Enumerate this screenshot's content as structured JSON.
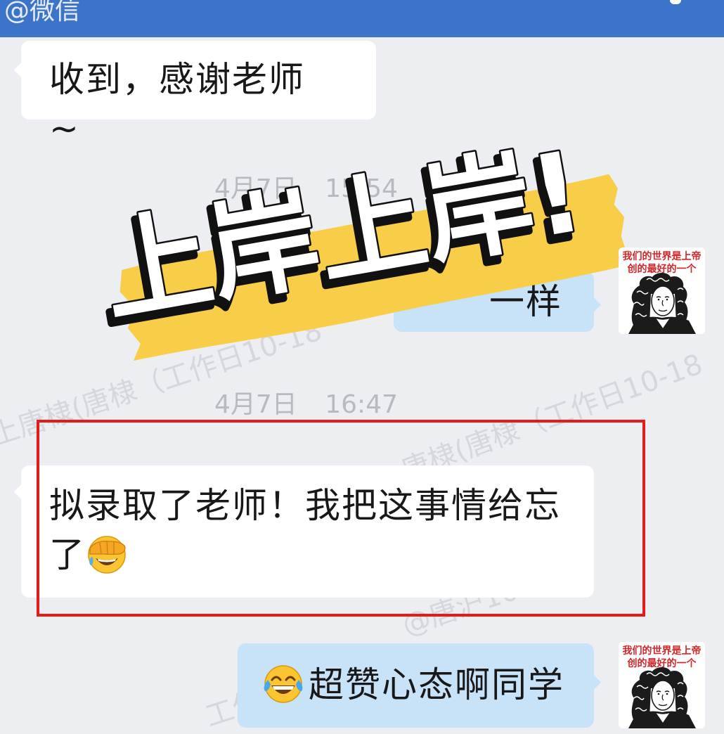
{
  "colors": {
    "background": "#eceef2",
    "topbar": "#3b74c9",
    "bubble_left": "#ffffff",
    "bubble_right": "#c8e2f7",
    "text": "#181818",
    "timestamp": "#b7babf",
    "highlight": "#e31b1b",
    "brush": "#f8cd47"
  },
  "topbar": {
    "handle": "@微信"
  },
  "chat": {
    "incoming_1": {
      "text": "收到，感谢老师 ~"
    },
    "time_1": "4月7日 15:54",
    "outgoing_1": {
      "text": "一样"
    },
    "time_2": "4月7日 16:47",
    "incoming_2": {
      "text": "拟录取了老师！我把这事情给忘了",
      "emoji": "facepalm-emoji"
    },
    "outgoing_2": {
      "emoji": "tears-of-joy-emoji",
      "text": "超赞心态啊同学"
    }
  },
  "avatar": {
    "caption_line1": "我们的世界是上帝",
    "caption_line2": "创的最好的一个",
    "icon": "portrait-icon"
  },
  "overlay": {
    "headline": "上岸上岸!"
  },
  "watermarks": [
    "上唐棣(唐棣（工作日10-18",
    "唐棣(唐棣（工作日10-18",
    "@唐沪10-1",
    "工作日1"
  ]
}
